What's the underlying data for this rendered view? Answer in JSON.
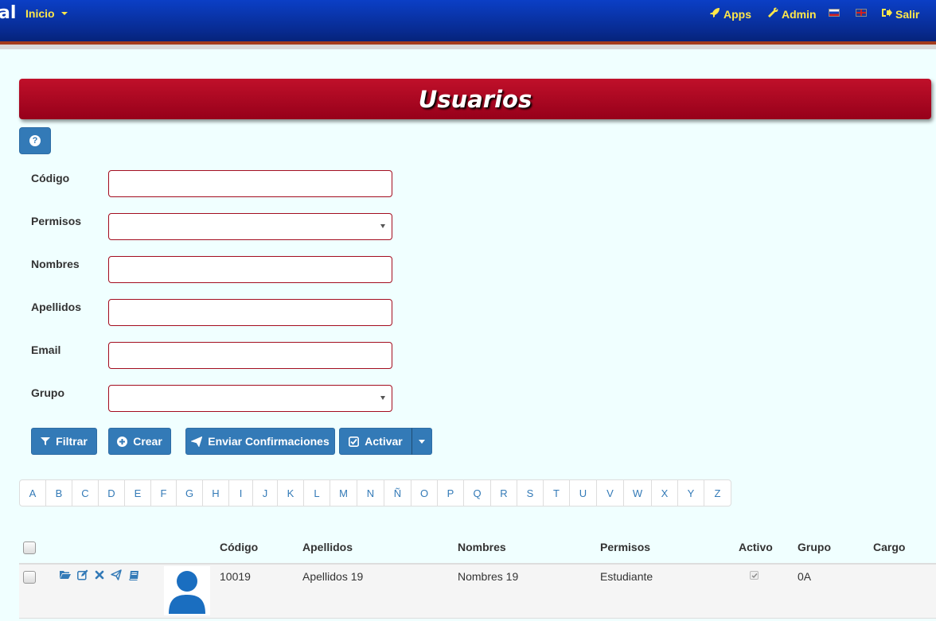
{
  "navbar": {
    "brand": "al",
    "inicio": "Inicio",
    "apps": "Apps",
    "admin": "Admin",
    "salir": "Salir",
    "colors": {
      "bg": "#082c94",
      "link": "#ffe74a",
      "stripe": "#a33b1c"
    }
  },
  "banner": {
    "title": "Usuarios",
    "color": "#a30d1f"
  },
  "form": {
    "codigo_label": "Código",
    "permisos_label": "Permisos",
    "nombres_label": "Nombres",
    "apellidos_label": "Apellidos",
    "email_label": "Email",
    "grupo_label": "Grupo",
    "codigo_value": "",
    "permisos_value": "",
    "nombres_value": "",
    "apellidos_value": "",
    "email_value": "",
    "grupo_value": ""
  },
  "buttons": {
    "filtrar": "Filtrar",
    "crear": "Crear",
    "enviar": "Enviar Confirmaciones",
    "activar": "Activar",
    "color": "#337ab7"
  },
  "alphabet": [
    "A",
    "B",
    "C",
    "D",
    "E",
    "F",
    "G",
    "H",
    "I",
    "J",
    "K",
    "L",
    "M",
    "N",
    "Ñ",
    "O",
    "P",
    "Q",
    "R",
    "S",
    "T",
    "U",
    "V",
    "W",
    "X",
    "Y",
    "Z"
  ],
  "table": {
    "headers": {
      "codigo": "Código",
      "apellidos": "Apellidos",
      "nombres": "Nombres",
      "permisos": "Permisos",
      "activo": "Activo",
      "grupo": "Grupo",
      "cargo": "Cargo"
    },
    "rows": [
      {
        "codigo": "10019",
        "apellidos": "Apellidos 19",
        "nombres": "Nombres 19",
        "permisos": "Estudiante",
        "activo": true,
        "grupo": "0A",
        "cargo": "",
        "actions": [
          "folder-open-icon",
          "edit-icon",
          "delete-icon",
          "send-icon",
          "book-icon"
        ]
      }
    ]
  }
}
